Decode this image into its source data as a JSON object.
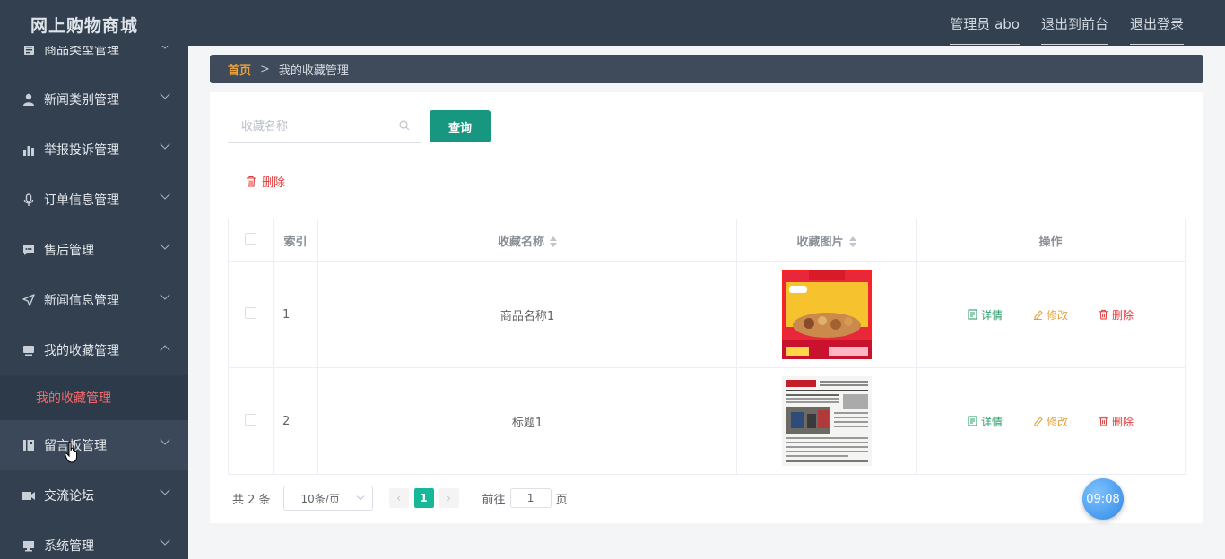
{
  "app": {
    "title": "网上购物商城"
  },
  "header": {
    "links": [
      "管理员 abo",
      "退出到前台",
      "退出登录"
    ]
  },
  "sidebar": {
    "items": [
      {
        "label": "商品类型管理",
        "icon": "document-icon"
      },
      {
        "label": "新闻类别管理",
        "icon": "user-icon"
      },
      {
        "label": "举报投诉管理",
        "icon": "bar-chart-icon"
      },
      {
        "label": "订单信息管理",
        "icon": "microphone-icon"
      },
      {
        "label": "售后管理",
        "icon": "chat-icon"
      },
      {
        "label": "新闻信息管理",
        "icon": "send-icon"
      },
      {
        "label": "我的收藏管理",
        "icon": "monitor-icon",
        "expanded": true
      },
      {
        "label": "留言板管理",
        "icon": "notebook-icon"
      },
      {
        "label": "交流论坛",
        "icon": "camera-icon"
      },
      {
        "label": "系统管理",
        "icon": "desktop-icon"
      }
    ],
    "sub_item": "我的收藏管理"
  },
  "breadcrumb": {
    "home": "首页",
    "sep": ">",
    "current": "我的收藏管理"
  },
  "search": {
    "placeholder": "收藏名称",
    "button": "查询"
  },
  "toolbar": {
    "delete": "删除"
  },
  "table": {
    "columns": [
      "索引",
      "收藏名称",
      "收藏图片",
      "操作"
    ],
    "rows": [
      {
        "index": "1",
        "name": "商品名称1",
        "image": "snack-gift-box-image"
      },
      {
        "index": "2",
        "name": "标题1",
        "image": "newspaper-image"
      }
    ],
    "actions": {
      "detail": "详情",
      "edit": "修改",
      "remove": "删除"
    }
  },
  "pagination": {
    "total": "共 2 条",
    "page_size": "10条/页",
    "current_page": "1",
    "goto_label": "前往",
    "goto_value": "1",
    "page_unit": "页"
  },
  "clock": {
    "time": "09:08"
  },
  "colors": {
    "sidebar": "#334050",
    "accent": "#17977f",
    "danger": "#e03a3a",
    "warning": "#e6a23c",
    "success": "#2e9d6a",
    "active_sub": "#f56c6c"
  }
}
